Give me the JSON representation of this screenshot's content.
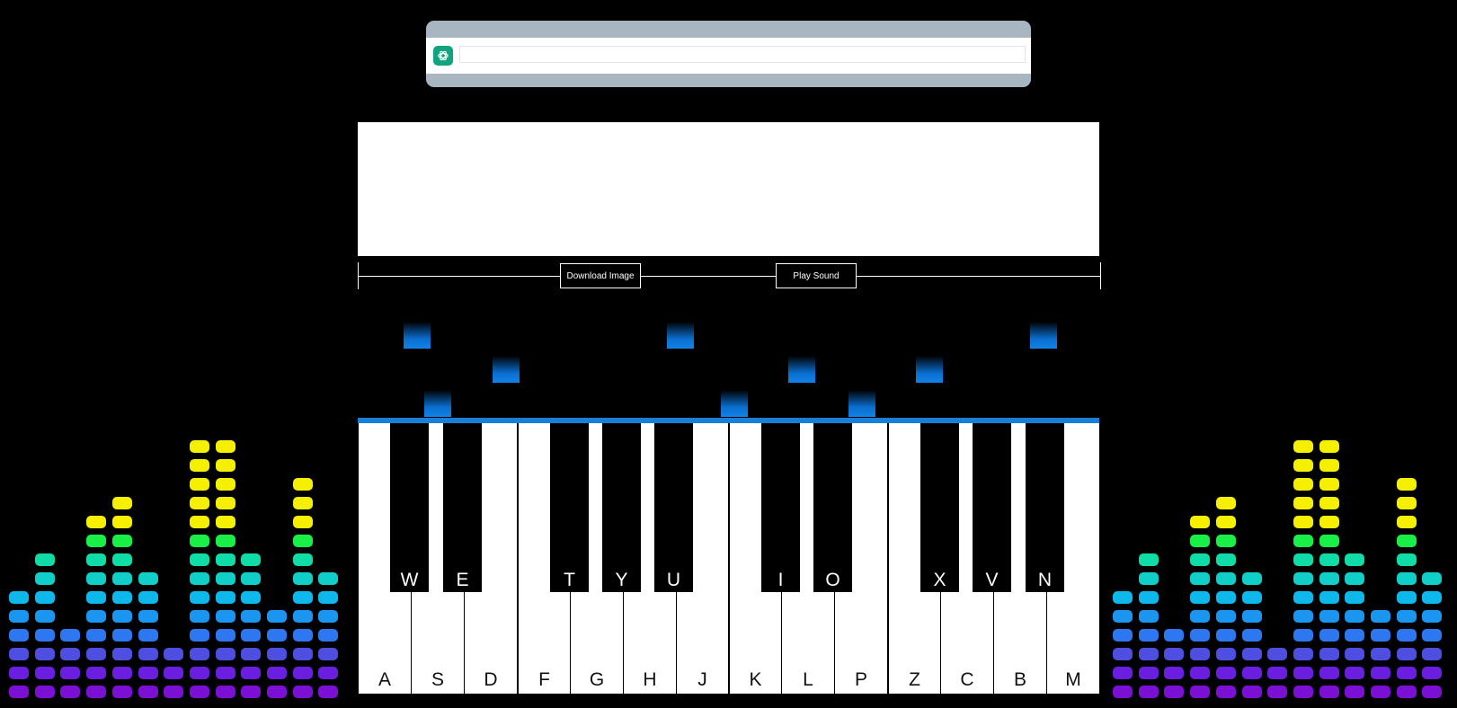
{
  "chat": {
    "input_value": "",
    "input_placeholder": "",
    "icon": "chatgpt-logo-icon",
    "icon_color": "#10a37f",
    "bar_color": "#a7b6c1"
  },
  "controls": {
    "download_label": "Download Image",
    "play_label": "Play Sound"
  },
  "piano": {
    "white_keys": [
      "A",
      "S",
      "D",
      "F",
      "G",
      "H",
      "J",
      "K",
      "L",
      "P",
      "Z",
      "C",
      "B",
      "M"
    ],
    "black_keys": [
      "W",
      "E",
      "T",
      "Y",
      "U",
      "I",
      "O",
      "X",
      "V",
      "N"
    ]
  },
  "equalizer": {
    "left_levels": [
      6,
      8,
      4,
      10,
      11,
      7,
      3,
      14,
      14,
      8,
      5,
      12,
      7
    ],
    "right_levels": [
      6,
      8,
      4,
      10,
      11,
      7,
      3,
      14,
      14,
      8,
      5,
      12,
      7
    ],
    "level_colors": [
      "#7b0fd4",
      "#6a1fe0",
      "#4e4ee0",
      "#2d77f0",
      "#1a96f0",
      "#0fb8ea",
      "#10cfc8",
      "#10dca8",
      "#18f048",
      "#f5f000",
      "#f5f000",
      "#f5f000",
      "#f5f000",
      "#f5f000"
    ]
  },
  "accent_color": "#1a7fd8"
}
